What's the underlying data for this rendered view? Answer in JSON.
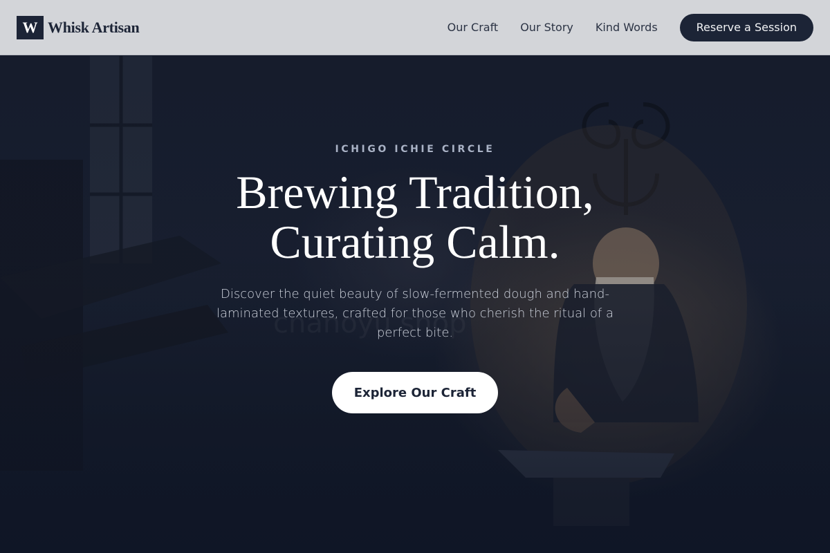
{
  "header": {
    "logo_mark": "W",
    "brand_name": "Whisk Artisan",
    "nav": [
      {
        "label": "Our Craft"
      },
      {
        "label": "Our Story"
      },
      {
        "label": "Kind Words"
      }
    ],
    "reserve_label": "Reserve a Session"
  },
  "hero": {
    "eyebrow": "ICHIGO ICHIE CIRCLE",
    "headline_line1": "Brewing Tradition,",
    "headline_line2": "Curating Calm.",
    "subtext": "Discover the quiet beauty of slow-fermented dough and hand-laminated textures, crafted for those who cherish the ritual of a perfect bite.",
    "cta_label": "Explore Our Craft",
    "background_image": "craftsman-at-anvil-photo"
  },
  "colors": {
    "header_bg": "#d3d5d9",
    "navy": "#1c2436",
    "hero_overlay": "#141b2c",
    "eyebrow": "#aab3c6",
    "white": "#ffffff"
  }
}
